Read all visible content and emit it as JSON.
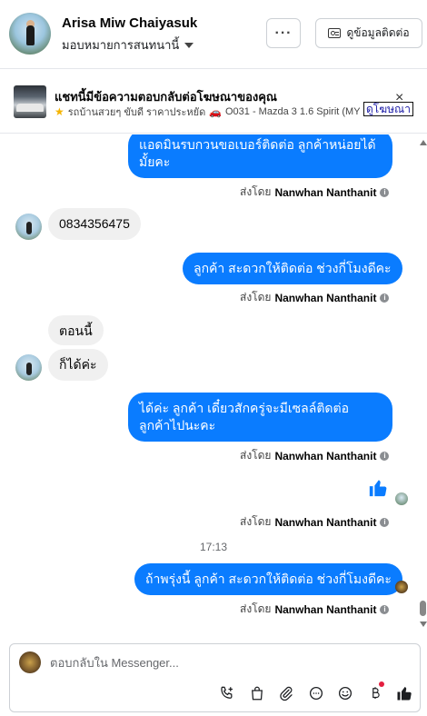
{
  "header": {
    "name": "Arisa Miw Chaiyasuk",
    "assignee_label": "มอบหมายการสนทนานี้",
    "more_label": "···",
    "contact_label": "ดูข้อมูลติดต่อ"
  },
  "ad": {
    "title": "แชทนี้มีข้อความตอบกลับต่อโฆษณาของคุณ",
    "shop": "รถบ้านสวยๆ ขับดี ราคาประหยัด",
    "car": "O031 - Mazda 3 1.6 Spirit (MY1...",
    "link_label": "ดูโฆษณา",
    "close_label": "×"
  },
  "messages": {
    "m1": "แอดมินรบกวนขอเบอร์ติดต่อ ลูกค้าหน่อยได้มั้ยคะ",
    "m1_sentby_prefix": "ส่งโดย",
    "m1_sentby_name": "Nanwhan Nanthanit",
    "m2": "0834356475",
    "m3": "ลูกค้า สะดวกให้ติดต่อ ช่วงกี่โมงดีคะ",
    "m3_sentby_prefix": "ส่งโดย",
    "m3_sentby_name": "Nanwhan Nanthanit",
    "m4": "ตอนนี้",
    "m5": "ก็ได้ค่ะ",
    "m6": "ได้ค่ะ  ลูกค้า เดี๋ยวสักครู่จะมีเซลล์ติดต่อ ลูกค้าไปนะคะ",
    "m6_sentby_prefix": "ส่งโดย",
    "m6_sentby_name": "Nanwhan Nanthanit",
    "like_sentby_prefix": "ส่งโดย",
    "like_sentby_name": "Nanwhan Nanthanit",
    "time": "17:13",
    "m7": "ถ้าพรุ่งนี้ ลูกค้า สะดวกให้ติดต่อ ช่วงกี่โมงดีคะ",
    "m7_sentby_prefix": "ส่งโดย",
    "m7_sentby_name": "Nanwhan Nanthanit"
  },
  "composer": {
    "placeholder": "ตอบกลับใน Messenger..."
  },
  "colors": {
    "accent": "#0a7cff",
    "incoming_bubble": "#f0f0f0",
    "badge": "#e41e3f"
  },
  "icons": [
    "phone-add-icon",
    "shopping-bag-icon",
    "paperclip-icon",
    "chat-bubble-icon",
    "smiley-icon",
    "baht-icon",
    "thumbs-up-icon"
  ]
}
